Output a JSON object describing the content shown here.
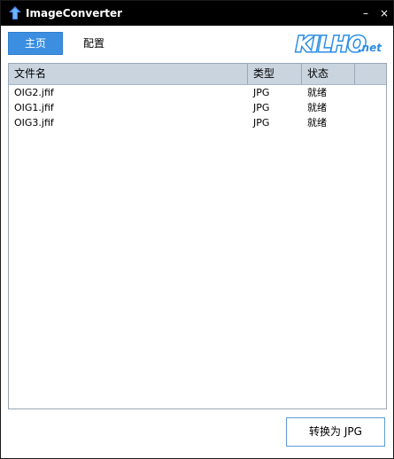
{
  "window": {
    "title": "ImageConverter",
    "minimize_glyph": "–",
    "close_glyph": "×",
    "icon": "app-arrow-icon"
  },
  "tabs": [
    {
      "label": "主页",
      "active": true
    },
    {
      "label": "配置",
      "active": false
    }
  ],
  "logo": {
    "main": "KILHO",
    "sub": ".net"
  },
  "file_list": {
    "columns": [
      "文件名",
      "类型",
      "状态"
    ],
    "rows": [
      {
        "name": "OIG2.jfif",
        "type": "JPG",
        "status": "就绪"
      },
      {
        "name": "OIG1.jfif",
        "type": "JPG",
        "status": "就绪"
      },
      {
        "name": "OIG3.jfif",
        "type": "JPG",
        "status": "就绪"
      }
    ]
  },
  "actions": {
    "convert_label": "转换为 JPG"
  },
  "colors": {
    "titlebar": "#000000",
    "accent": "#3c8fe0",
    "header": "#c9d4df",
    "logo_blue": "#2b8ee6"
  }
}
